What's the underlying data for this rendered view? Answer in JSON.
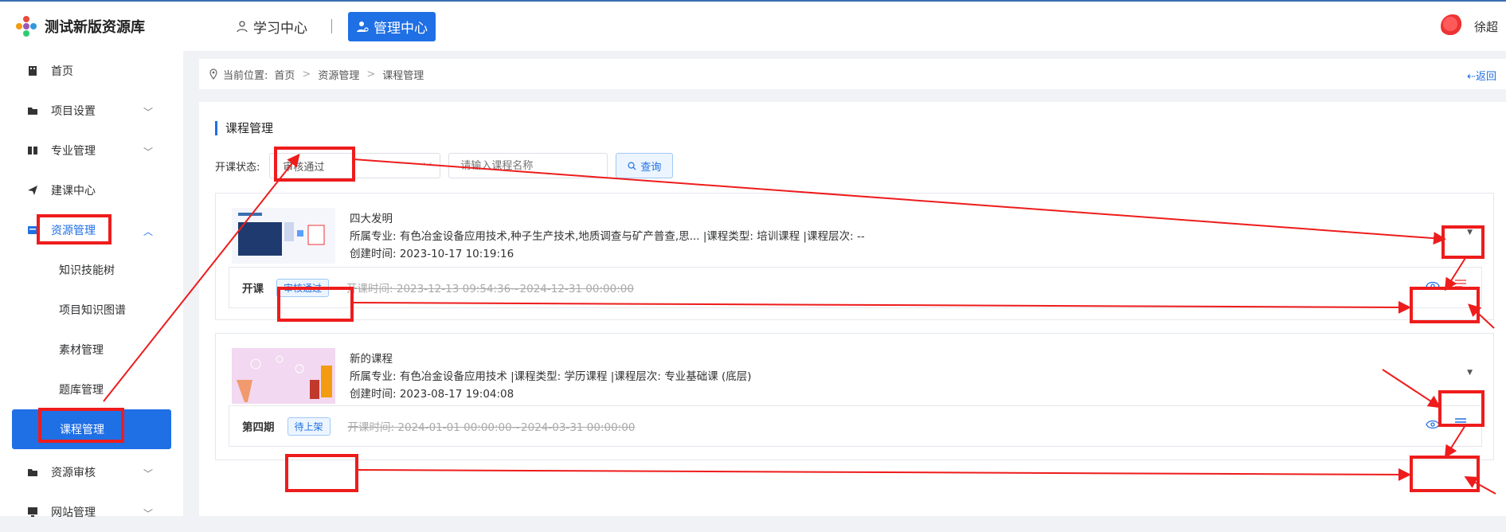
{
  "header": {
    "app_title": "测试新版资源库",
    "nav": [
      {
        "label": "学习中心"
      },
      {
        "label": "管理中心"
      }
    ],
    "user_name": "徐超"
  },
  "sidebar": {
    "items": [
      {
        "label": "首页",
        "icon": "building-icon"
      },
      {
        "label": "项目设置",
        "icon": "folder-icon"
      },
      {
        "label": "专业管理",
        "icon": "book-icon"
      },
      {
        "label": "建课中心",
        "icon": "paper-plane-icon"
      },
      {
        "label": "资源管理",
        "icon": "box-icon"
      },
      {
        "label": "资源审核",
        "icon": "folder-icon"
      },
      {
        "label": "网站管理",
        "icon": "monitor-icon"
      }
    ],
    "sub_items": [
      "知识技能树",
      "项目知识图谱",
      "素材管理",
      "题库管理",
      "课程管理"
    ]
  },
  "breadcrumb": {
    "prefix": "当前位置:",
    "items": [
      "首页",
      "资源管理",
      "课程管理"
    ],
    "back": "⇠返回"
  },
  "main": {
    "section_title": "课程管理",
    "filter": {
      "label": "开课状态:",
      "selected": "审核通过",
      "search_placeholder": "请输入课程名称",
      "query_label": "查询"
    },
    "courses": [
      {
        "title": "四大发明",
        "meta": "所属专业: 有色冶金设备应用技术,种子生产技术,地质调查与矿产普查,思... |课程类型: 培训课程 |课程层次: --",
        "created": "创建时间: 2023-10-17 10:19:16",
        "term": {
          "name": "开课",
          "status": "审核通过",
          "dates": "开课时间: 2023-12-13 09:54:36~2024-12-31 00:00:00"
        }
      },
      {
        "title": "新的课程",
        "meta": "所属专业: 有色冶金设备应用技术  |课程类型: 学历课程 |课程层次: 专业基础课 (底层)",
        "created": "创建时间: 2023-08-17 19:04:08",
        "term": {
          "name": "第四期",
          "status": "待上架",
          "dates": "开课时间: 2024-01-01 00:00:00~2024-03-31 00:00:00"
        }
      }
    ]
  },
  "colors": {
    "accent": "#1f6fe5",
    "annotation": "#ee1c1c"
  }
}
